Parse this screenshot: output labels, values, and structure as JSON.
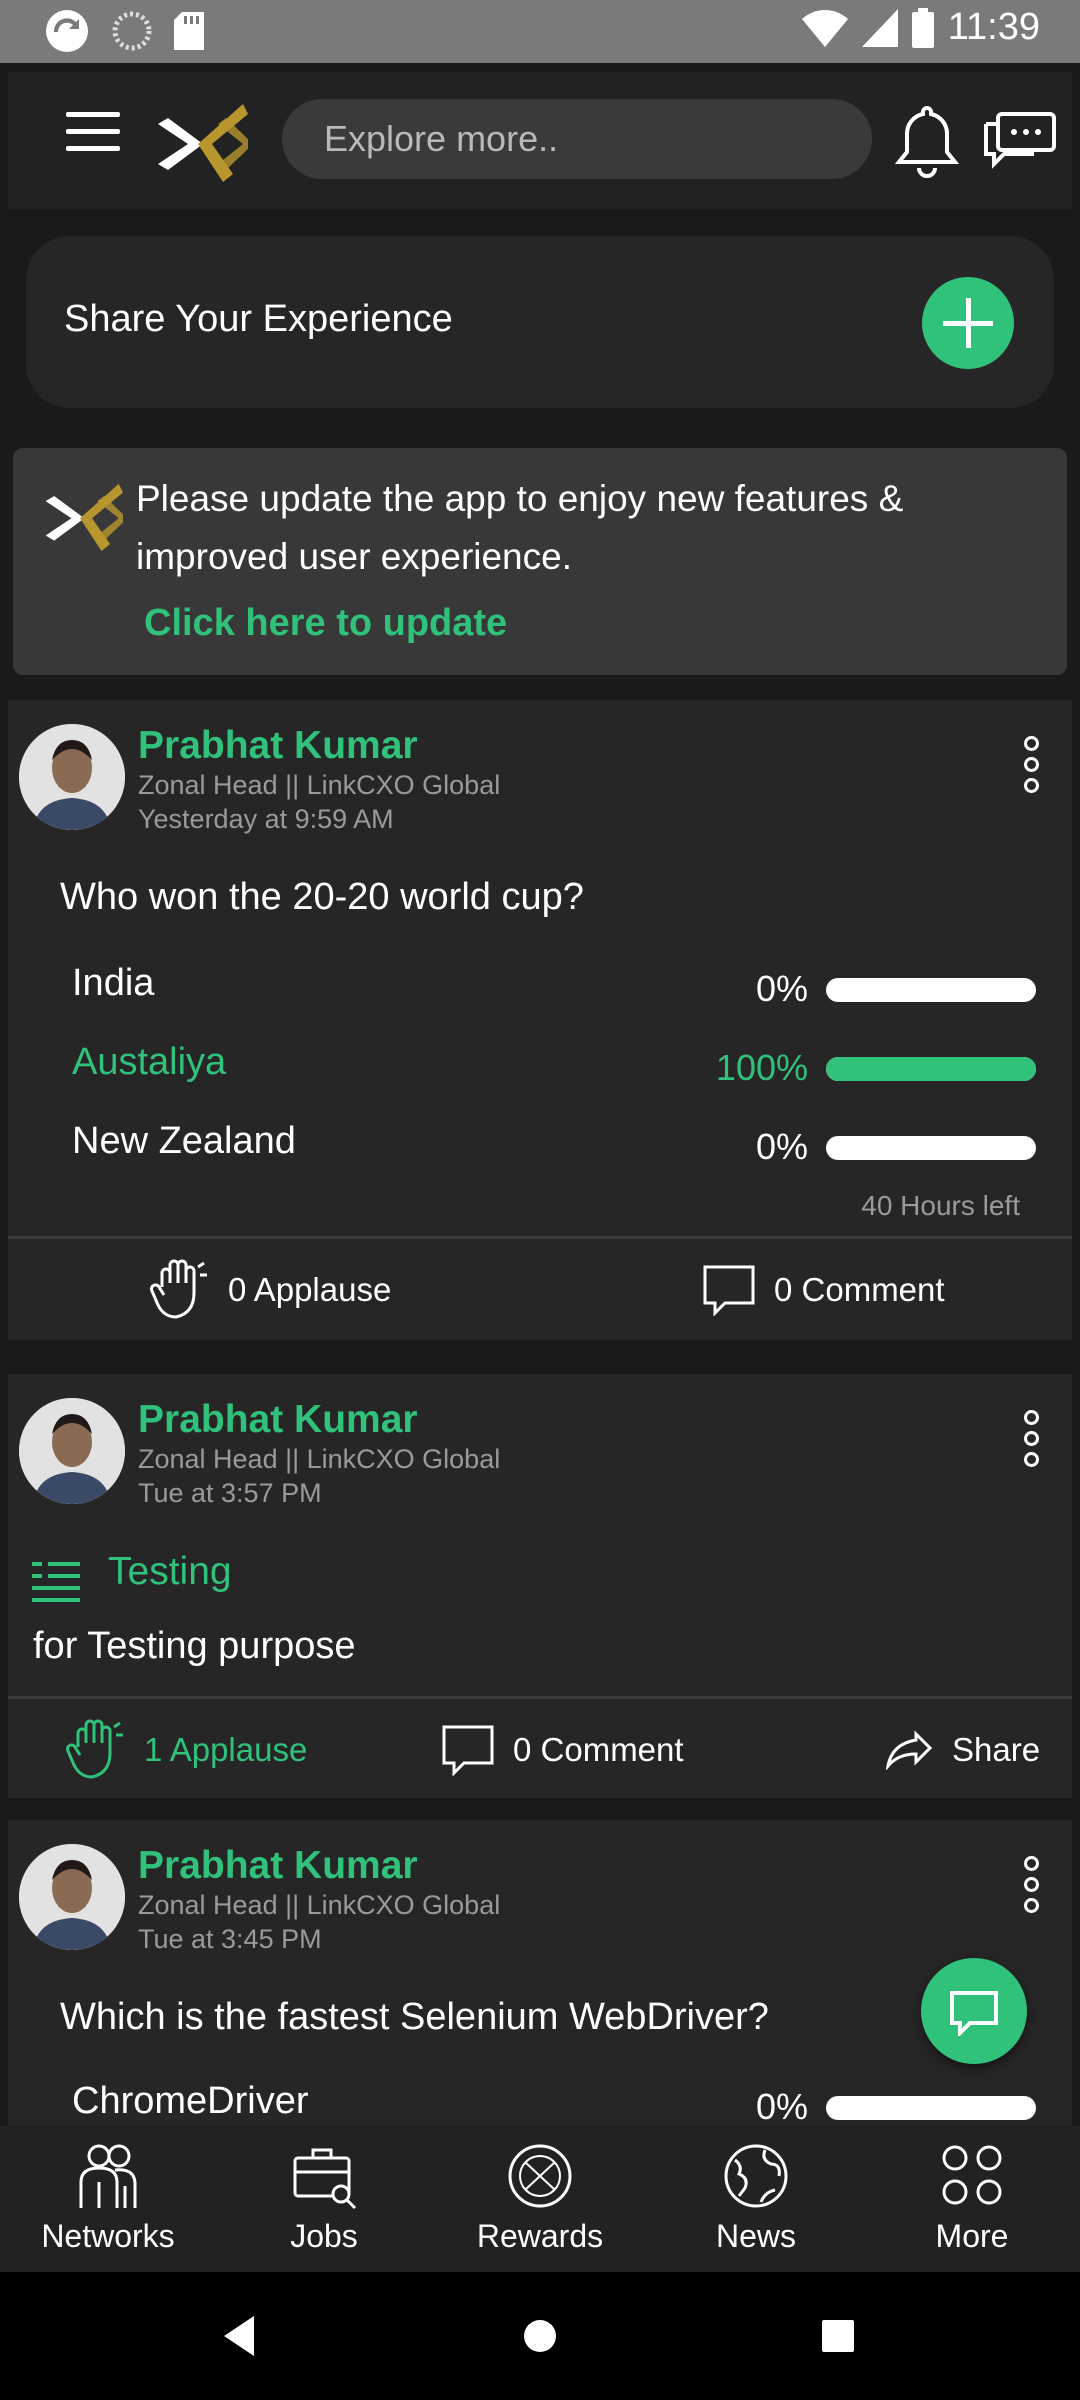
{
  "status_bar": {
    "time": "11:39"
  },
  "header": {
    "search_placeholder": "Explore more.."
  },
  "share": {
    "label": "Share Your Experience"
  },
  "update_banner": {
    "message": "Please update the app to enjoy new features & improved user experience.",
    "link": "Click here to update"
  },
  "colors": {
    "accent": "#30c17a",
    "background": "#1a1a1a",
    "card": "#262626"
  },
  "posts": [
    {
      "author": "Prabhat Kumar",
      "role": "Zonal Head ||  LinkCXO Global",
      "time": "Yesterday at 9:59 AM",
      "question": "Who won the 20-20 world cup?",
      "options": [
        {
          "label": "India",
          "percent": "0%",
          "value": 0
        },
        {
          "label": "Austaliya",
          "percent": "100%",
          "value": 100
        },
        {
          "label": "New Zealand",
          "percent": "0%",
          "value": 0
        }
      ],
      "time_left": "40 Hours left",
      "applause": "0 Applause",
      "comment": "0 Comment"
    },
    {
      "author": "Prabhat Kumar",
      "role": "Zonal Head ||  LinkCXO Global",
      "time": "Tue at 3:57 PM",
      "title": "Testing",
      "body": "for Testing purpose",
      "applause": "1 Applause",
      "comment": "0 Comment",
      "share": "Share"
    },
    {
      "author": "Prabhat Kumar",
      "role": "Zonal Head ||  LinkCXO Global",
      "time": "Tue at 3:45 PM",
      "question": "Which is the fastest Selenium WebDriver?",
      "options": [
        {
          "label": "ChromeDriver",
          "percent": "0%",
          "value": 0
        }
      ]
    }
  ],
  "bottom_nav": [
    {
      "label": "Networks",
      "icon": "networks-icon"
    },
    {
      "label": "Jobs",
      "icon": "jobs-icon"
    },
    {
      "label": "Rewards",
      "icon": "rewards-icon"
    },
    {
      "label": "News",
      "icon": "news-icon"
    },
    {
      "label": "More",
      "icon": "more-icon"
    }
  ]
}
